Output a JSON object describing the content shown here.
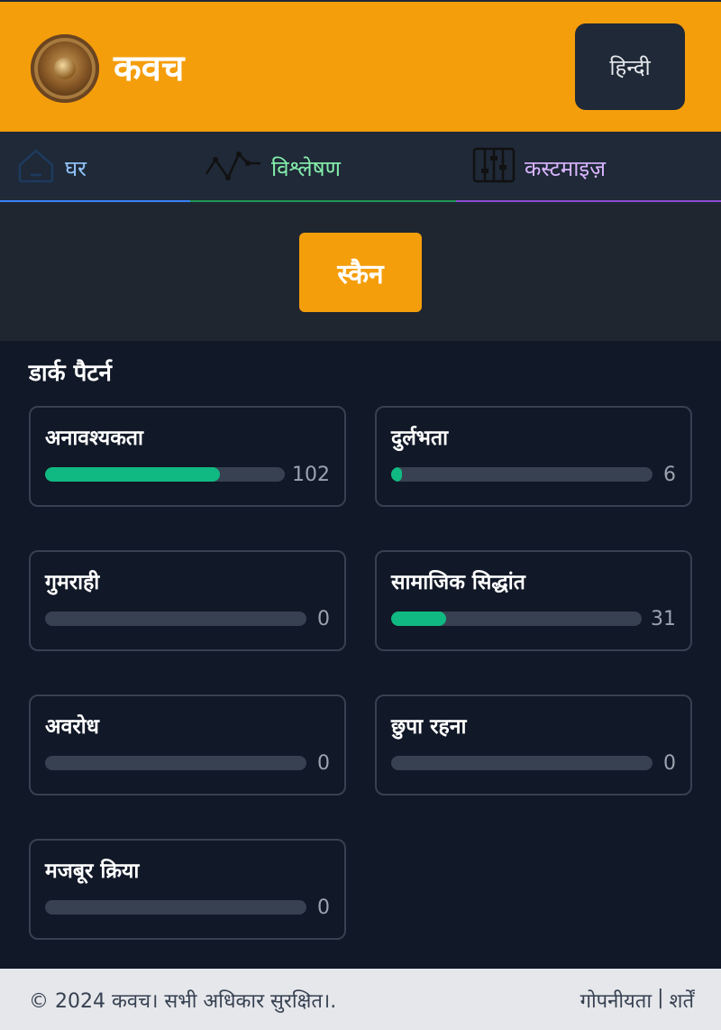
{
  "header": {
    "app_title": "कवच",
    "language_button": "हिन्दी"
  },
  "tabs": [
    {
      "label": "घर",
      "icon": "home-icon",
      "color": "#93c5fd"
    },
    {
      "label": "विश्लेषण",
      "icon": "activity-chart-icon",
      "color": "#86efac"
    },
    {
      "label": "कस्टमाइज़",
      "icon": "sliders-icon",
      "color": "#d8b4fe"
    }
  ],
  "scan": {
    "label": "स्कैन",
    "color": "#f59e0b"
  },
  "dark_patterns": {
    "title": "डार्क पैटर्न",
    "items": [
      {
        "label": "अनावश्यकता",
        "count": "102",
        "fill_percent": 73
      },
      {
        "label": "दुर्लभता",
        "count": "6",
        "fill_percent": 4
      },
      {
        "label": "गुमराही",
        "count": "0",
        "fill_percent": 0
      },
      {
        "label": "सामाजिक सिद्धांत",
        "count": "31",
        "fill_percent": 22
      },
      {
        "label": "अवरोध",
        "count": "0",
        "fill_percent": 0
      },
      {
        "label": "छुपा रहना",
        "count": "0",
        "fill_percent": 0
      },
      {
        "label": "मजबूर क्रिया",
        "count": "0",
        "fill_percent": 0
      }
    ]
  },
  "footer": {
    "copyright": "© 2024 कवच। सभी अधिकार सुरक्षित।.",
    "privacy": "गोपनीयता",
    "separator": "|",
    "terms": "शर्तें"
  }
}
